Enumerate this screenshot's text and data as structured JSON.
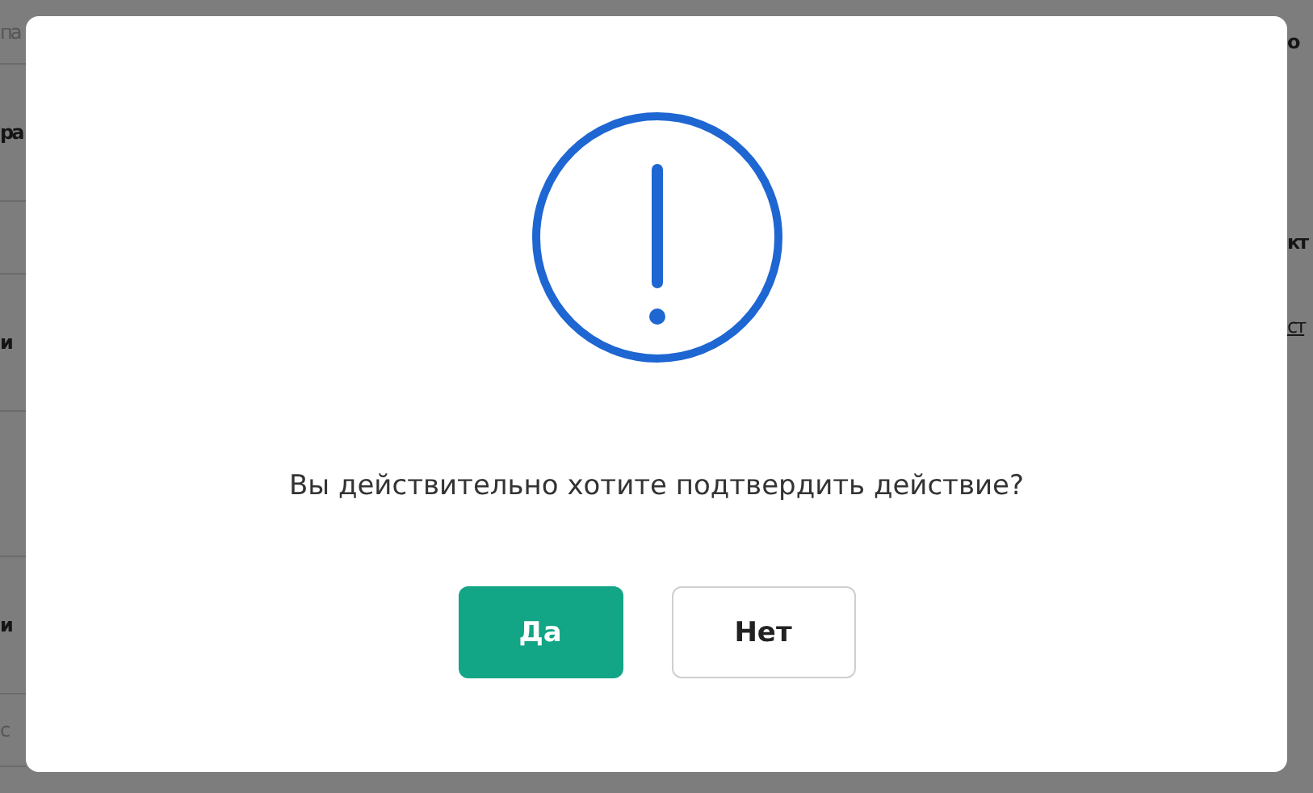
{
  "background": {
    "left": [
      {
        "text": "па",
        "kind": "hint"
      },
      {
        "text": "ра",
        "kind": "heading"
      },
      {
        "text": "и",
        "kind": "heading"
      },
      {
        "text": "и",
        "kind": "heading"
      },
      {
        "text": "с",
        "kind": "hint"
      }
    ],
    "right": [
      {
        "text": "о",
        "kind": "heading"
      },
      {
        "text": "кт",
        "kind": "heading"
      },
      {
        "text": "ст",
        "kind": "link"
      }
    ]
  },
  "dialog": {
    "message": "Вы действительно хотите подтвердить действие?",
    "buttons": [
      {
        "label": "Да",
        "kind": "primary"
      },
      {
        "label": "Нет",
        "kind": "secondary"
      }
    ]
  }
}
